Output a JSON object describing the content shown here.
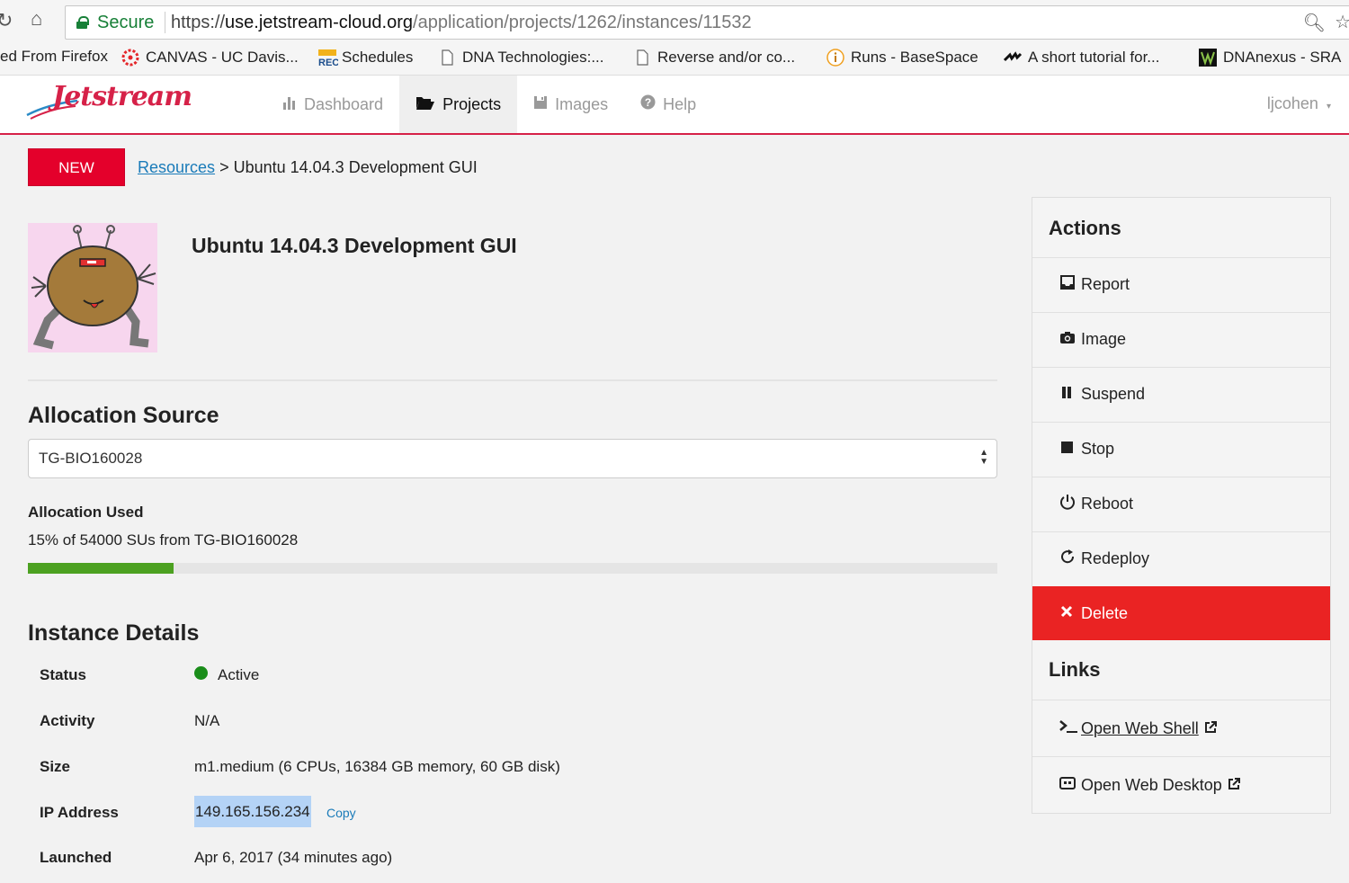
{
  "browser": {
    "secure_label": "Secure",
    "url_scheme": "https://",
    "url_host": "use.jetstream-cloud.org",
    "url_path": "/application/projects/1262/instances/11532",
    "bookmarks": [
      {
        "label": "ed From Firefox",
        "icon": ""
      },
      {
        "label": "CANVAS - UC Davis...",
        "icon": "canvas-icon"
      },
      {
        "label": "Schedules",
        "icon": "rec-icon"
      },
      {
        "label": "DNA Technologies:...",
        "icon": "page-icon"
      },
      {
        "label": "Reverse and/or co...",
        "icon": "page-icon"
      },
      {
        "label": "Runs - BaseSpace",
        "icon": "info-icon"
      },
      {
        "label": "A short tutorial for...",
        "icon": "bird-icon"
      },
      {
        "label": "DNAnexus - SRA",
        "icon": "dnanexus-icon"
      }
    ]
  },
  "header": {
    "logo_text": "Jetstream",
    "nav": [
      {
        "label": "Dashboard",
        "icon": "bar-chart-icon",
        "active": false
      },
      {
        "label": "Projects",
        "icon": "folder-open-icon",
        "active": true
      },
      {
        "label": "Images",
        "icon": "floppy-icon",
        "active": false
      },
      {
        "label": "Help",
        "icon": "question-icon",
        "active": false
      }
    ],
    "user": "ljcohen"
  },
  "toolbar": {
    "new_label": "NEW",
    "breadcrumb_link": "Resources",
    "breadcrumb_sep": ">",
    "breadcrumb_current": "Ubuntu 14.04.3 Development GUI"
  },
  "instance": {
    "name": "Ubuntu 14.04.3 Development GUI"
  },
  "allocation": {
    "heading": "Allocation Source",
    "selected": "TG-BIO160028",
    "used_label": "Allocation Used",
    "used_text": "15% of 54000 SUs from TG-BIO160028",
    "used_fraction": 0.15
  },
  "details": {
    "heading": "Instance Details",
    "rows": [
      {
        "label": "Status",
        "value": "Active"
      },
      {
        "label": "Activity",
        "value": "N/A"
      },
      {
        "label": "Size",
        "value": "m1.medium (6 CPUs, 16384 GB memory, 60 GB disk)"
      },
      {
        "label": "IP Address",
        "value": "149.165.156.234"
      },
      {
        "label": "Launched",
        "value": "Apr 6, 2017 (34 minutes ago)"
      }
    ],
    "copy_label": "Copy",
    "status_color": "#1a8d1a"
  },
  "sidebar": {
    "actions_heading": "Actions",
    "actions": [
      {
        "label": "Report",
        "icon": "inbox-icon"
      },
      {
        "label": "Image",
        "icon": "camera-icon"
      },
      {
        "label": "Suspend",
        "icon": "pause-icon"
      },
      {
        "label": "Stop",
        "icon": "stop-icon"
      },
      {
        "label": "Reboot",
        "icon": "power-icon"
      },
      {
        "label": "Redeploy",
        "icon": "refresh-icon"
      },
      {
        "label": "Delete",
        "icon": "close-icon"
      }
    ],
    "links_heading": "Links",
    "links": [
      {
        "label": "Open Web Shell",
        "icon": "terminal-icon"
      },
      {
        "label": "Open Web Desktop",
        "icon": "desktop-icon"
      }
    ],
    "delete_color": "#ea2323"
  },
  "colors": {
    "brand": "#d62148",
    "new_button": "#e4002b",
    "progress": "#4ca121",
    "link": "#1a7bb9"
  }
}
